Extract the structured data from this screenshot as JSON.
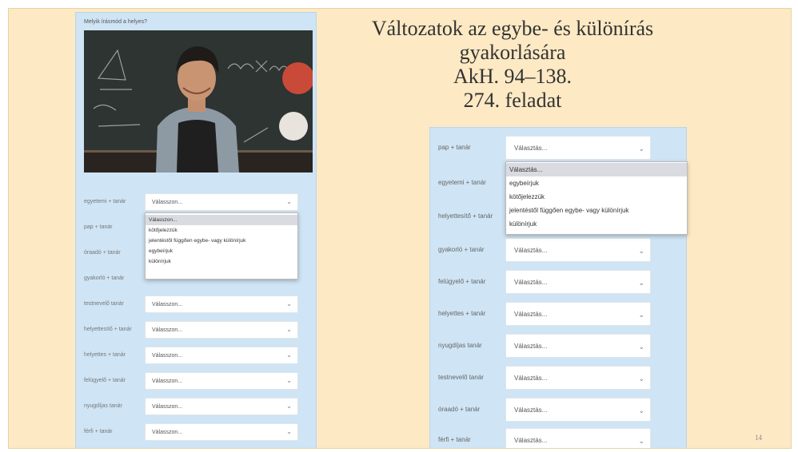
{
  "slide": {
    "title_lines": [
      "Változatok az egybe- és különírás",
      "gyakorlására",
      "AkH. 94–138.",
      "274. feladat"
    ],
    "page_number": "14"
  },
  "left_form": {
    "question": "Melyik írásmód a helyes?",
    "photo_icon": "teacher-photo-icon",
    "rows": [
      {
        "label": "egyetemi + tanár",
        "value": "Válasszon..."
      },
      {
        "label": "pap + tanár",
        "value": ""
      },
      {
        "label": "óraadó + tanár",
        "value": ""
      },
      {
        "label": "gyakorló + tanár",
        "value": ""
      },
      {
        "label": "testnevelő tanár",
        "value": "Válasszon..."
      },
      {
        "label": "helyettesítő + tanár",
        "value": "Válasszon..."
      },
      {
        "label": "helyettes + tanár",
        "value": "Válasszon..."
      },
      {
        "label": "felügyelő + tanár",
        "value": "Válasszon..."
      },
      {
        "label": "nyugdíjas tanár",
        "value": "Válasszon..."
      },
      {
        "label": "férfi + tanár",
        "value": "Válasszon..."
      }
    ],
    "dropdown_options": [
      "Válasszon...",
      "kötőjelezzük",
      "jelentéstől függően egybe- vagy különírjuk",
      "egybeírjuk",
      "különírjuk"
    ]
  },
  "right_form": {
    "rows": [
      {
        "label": "pap + tanár",
        "value": "Választás..."
      },
      {
        "label": "egyetemi + tanár",
        "value": ""
      },
      {
        "label": "helyettesítő + tanár",
        "value": ""
      },
      {
        "label": "gyakorló + tanár",
        "value": "Választás..."
      },
      {
        "label": "felügyelő + tanár",
        "value": "Választás..."
      },
      {
        "label": "helyettes + tanár",
        "value": "Választás..."
      },
      {
        "label": "nyugdíjas tanár",
        "value": "Választás..."
      },
      {
        "label": "testnevelő tanár",
        "value": "Választás..."
      },
      {
        "label": "óraadó + tanár",
        "value": "Választás..."
      },
      {
        "label": "férfi + tanár",
        "value": "Választás..."
      }
    ],
    "dropdown_options": [
      "Választás...",
      "egybeírjuk",
      "kötőjelezzük",
      "jelentéstől függően egybe- vagy különírjuk",
      "különírjuk"
    ]
  },
  "colors": {
    "slide_bg": "#fde9c4",
    "panel_bg": "#cfe4f4"
  }
}
